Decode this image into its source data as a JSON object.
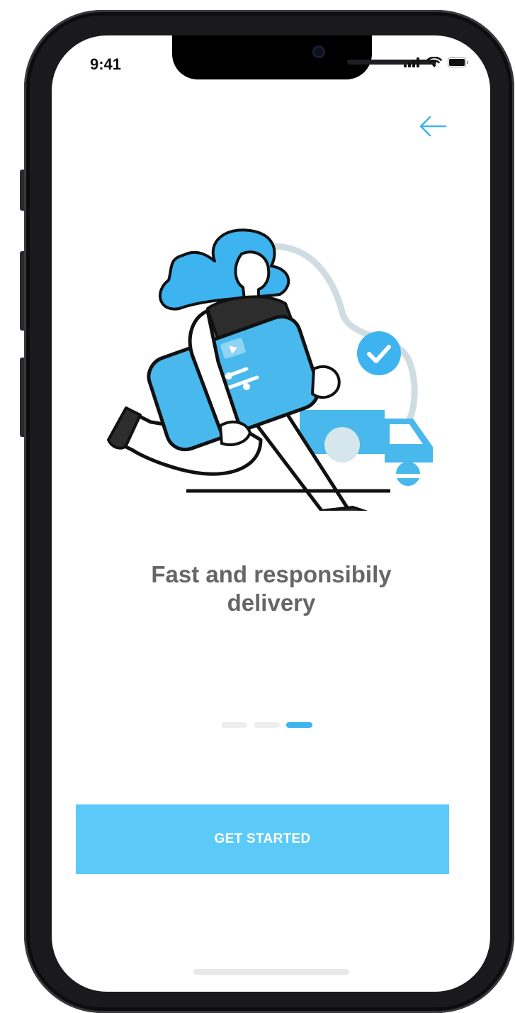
{
  "status_bar": {
    "time": "9:41",
    "icons": [
      "signal-icon",
      "wifi-icon",
      "battery-icon"
    ]
  },
  "nav": {
    "back_icon": "arrow-left-icon"
  },
  "illustration": {
    "name": "courier-running-with-package-illustration",
    "accent_color": "#3db3ef"
  },
  "onboarding": {
    "title_line1": "Fast and responsibily",
    "title_line2": "delivery",
    "page_indicator": {
      "total": 3,
      "current": 3
    }
  },
  "cta": {
    "label": "GET STARTED"
  },
  "colors": {
    "accent": "#3db3ef",
    "button": "#5ccaf8",
    "title_text": "#666666"
  }
}
